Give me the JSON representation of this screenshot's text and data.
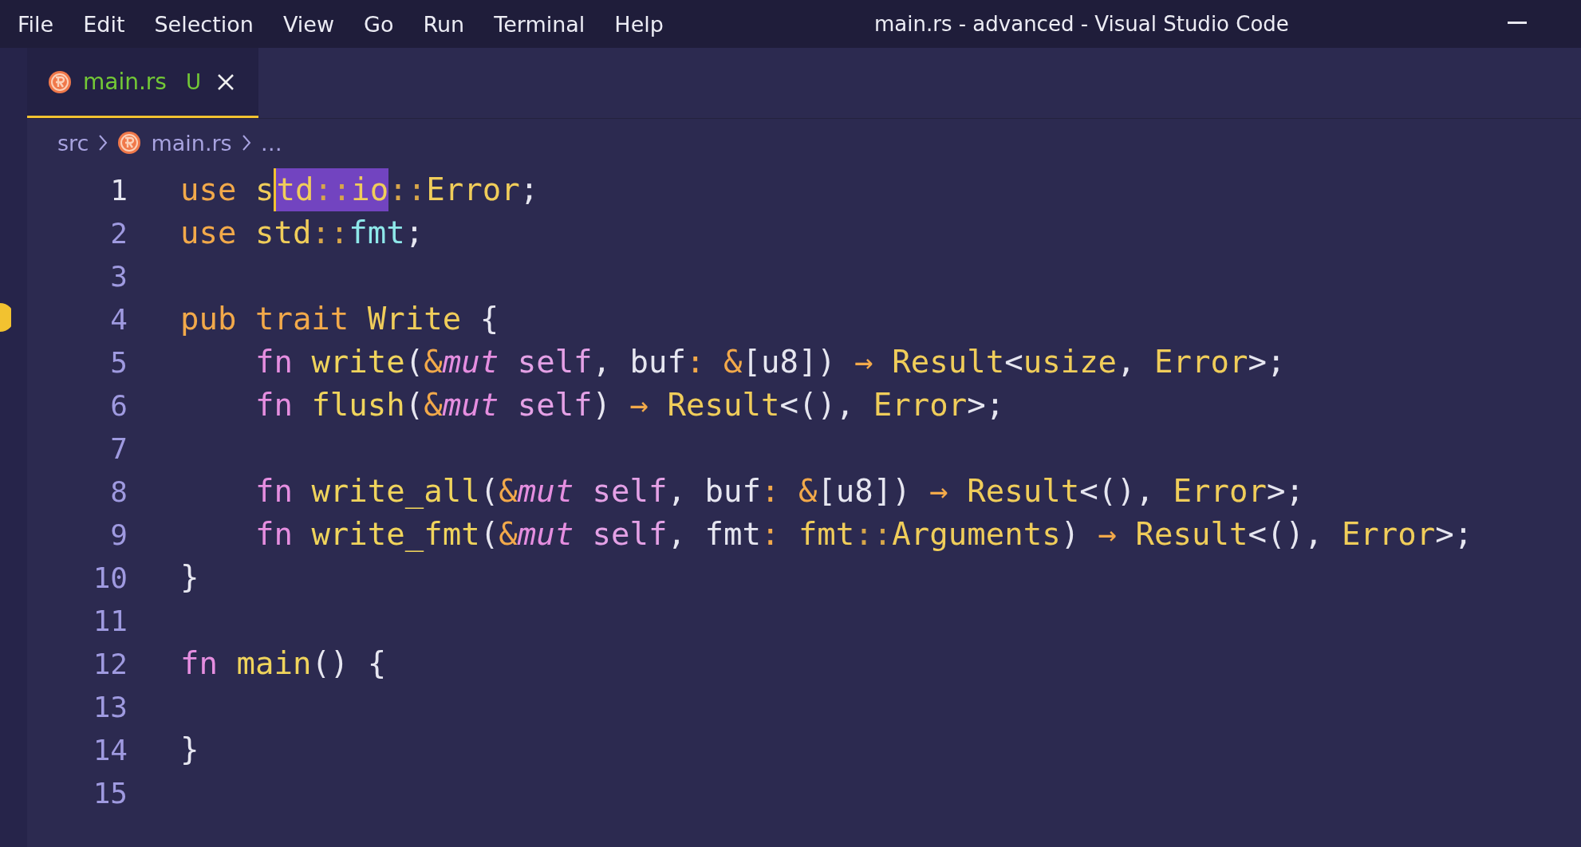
{
  "menu": [
    "File",
    "Edit",
    "Selection",
    "View",
    "Go",
    "Run",
    "Terminal",
    "Help"
  ],
  "window": {
    "title": "main.rs - advanced - Visual Studio Code"
  },
  "tabs": [
    {
      "label": "main.rs",
      "status": "U",
      "selected": true
    }
  ],
  "breadcrumb": [
    {
      "label": "src",
      "kind": "folder"
    },
    {
      "label": "main.rs",
      "kind": "file"
    },
    {
      "label": "…",
      "kind": "more"
    }
  ],
  "lines": [
    {
      "number": "1",
      "active": true,
      "tokens": [
        {
          "t": "use ",
          "kind": "kw",
          "selected": false,
          "cursor": false
        },
        {
          "t": "s",
          "kind": "ns",
          "selected": false,
          "cursor": false
        },
        {
          "t": "td",
          "kind": "ns",
          "selected": true,
          "cursor": true
        },
        {
          "t": "::",
          "kind": "sep",
          "selected": true,
          "cursor": false
        },
        {
          "t": "io",
          "kind": "ns",
          "selected": true,
          "cursor": false
        },
        {
          "t": "::",
          "kind": "sep",
          "selected": false,
          "cursor": false
        },
        {
          "t": "Error",
          "kind": "type",
          "selected": false,
          "cursor": false
        },
        {
          "t": ";",
          "kind": "punct",
          "selected": false,
          "cursor": false
        }
      ]
    },
    {
      "number": "2",
      "active": false,
      "tokens": [
        {
          "t": "use ",
          "kind": "kw"
        },
        {
          "t": "std",
          "kind": "ns"
        },
        {
          "t": "::",
          "kind": "sep"
        },
        {
          "t": "fmt",
          "kind": "mod"
        },
        {
          "t": ";",
          "kind": "punct"
        }
      ]
    },
    {
      "number": "3",
      "active": false
    },
    {
      "number": "4",
      "active": false,
      "tokens": [
        {
          "t": "pub trait ",
          "kind": "kw"
        },
        {
          "t": "Write",
          "kind": "type"
        },
        {
          "t": " {",
          "kind": "punct"
        }
      ]
    },
    {
      "number": "5",
      "active": false,
      "tokens": [
        {
          "t": "    fn ",
          "kind": "fnkw"
        },
        {
          "t": "write",
          "kind": "name"
        },
        {
          "t": "(",
          "kind": "punct"
        },
        {
          "t": "&",
          "kind": "amp"
        },
        {
          "t": "mut ",
          "kind": "mut"
        },
        {
          "t": "self",
          "kind": "self"
        },
        {
          "t": ", buf",
          "kind": "punct"
        },
        {
          "t": ": ",
          "kind": "colon"
        },
        {
          "t": "&",
          "kind": "amp"
        },
        {
          "t": "[u8]) ",
          "kind": "punct"
        },
        {
          "t": "→ ",
          "kind": "arrow"
        },
        {
          "t": "Result",
          "kind": "type"
        },
        {
          "t": "<",
          "kind": "punct"
        },
        {
          "t": "usize",
          "kind": "type"
        },
        {
          "t": ", ",
          "kind": "punct"
        },
        {
          "t": "Error",
          "kind": "type"
        },
        {
          "t": ">;",
          "kind": "punct"
        }
      ]
    },
    {
      "number": "6",
      "active": false,
      "tokens": [
        {
          "t": "    fn ",
          "kind": "fnkw"
        },
        {
          "t": "flush",
          "kind": "name"
        },
        {
          "t": "(",
          "kind": "punct"
        },
        {
          "t": "&",
          "kind": "amp"
        },
        {
          "t": "mut ",
          "kind": "mut"
        },
        {
          "t": "self",
          "kind": "self"
        },
        {
          "t": ") ",
          "kind": "punct"
        },
        {
          "t": "→ ",
          "kind": "arrow"
        },
        {
          "t": "Result",
          "kind": "type"
        },
        {
          "t": "<(), ",
          "kind": "punct"
        },
        {
          "t": "Error",
          "kind": "type"
        },
        {
          "t": ">;",
          "kind": "punct"
        }
      ]
    },
    {
      "number": "7",
      "active": false
    },
    {
      "number": "8",
      "active": false,
      "tokens": [
        {
          "t": "    fn ",
          "kind": "fnkw"
        },
        {
          "t": "write_all",
          "kind": "name"
        },
        {
          "t": "(",
          "kind": "punct"
        },
        {
          "t": "&",
          "kind": "amp"
        },
        {
          "t": "mut ",
          "kind": "mut"
        },
        {
          "t": "self",
          "kind": "self"
        },
        {
          "t": ", buf",
          "kind": "punct"
        },
        {
          "t": ": ",
          "kind": "colon"
        },
        {
          "t": "&",
          "kind": "amp"
        },
        {
          "t": "[u8]) ",
          "kind": "punct"
        },
        {
          "t": "→ ",
          "kind": "arrow"
        },
        {
          "t": "Result",
          "kind": "type"
        },
        {
          "t": "<(), ",
          "kind": "punct"
        },
        {
          "t": "Error",
          "kind": "type"
        },
        {
          "t": ">;",
          "kind": "punct"
        }
      ]
    },
    {
      "number": "9",
      "active": false,
      "tokens": [
        {
          "t": "    fn ",
          "kind": "fnkw"
        },
        {
          "t": "write_fmt",
          "kind": "name"
        },
        {
          "t": "(",
          "kind": "punct"
        },
        {
          "t": "&",
          "kind": "amp"
        },
        {
          "t": "mut ",
          "kind": "mut"
        },
        {
          "t": "self",
          "kind": "self"
        },
        {
          "t": ", fmt",
          "kind": "punct"
        },
        {
          "t": ": ",
          "kind": "colon"
        },
        {
          "t": "fmt",
          "kind": "ns"
        },
        {
          "t": "::",
          "kind": "sep"
        },
        {
          "t": "Arguments",
          "kind": "type"
        },
        {
          "t": ") ",
          "kind": "punct"
        },
        {
          "t": "→ ",
          "kind": "arrow"
        },
        {
          "t": "Result",
          "kind": "type"
        },
        {
          "t": "<(), ",
          "kind": "punct"
        },
        {
          "t": "Error",
          "kind": "type"
        },
        {
          "t": ">;",
          "kind": "punct"
        }
      ]
    },
    {
      "number": "10",
      "active": false,
      "tokens": [
        {
          "t": "}",
          "kind": "punct"
        }
      ]
    },
    {
      "number": "11",
      "active": false
    },
    {
      "number": "12",
      "active": false,
      "tokens": [
        {
          "t": "fn ",
          "kind": "fnkw"
        },
        {
          "t": "main",
          "kind": "name"
        },
        {
          "t": "() {",
          "kind": "punct"
        }
      ]
    },
    {
      "number": "13",
      "active": false
    },
    {
      "number": "14",
      "active": false,
      "tokens": [
        {
          "t": "}",
          "kind": "punct"
        }
      ]
    },
    {
      "number": "15",
      "active": false
    }
  ]
}
